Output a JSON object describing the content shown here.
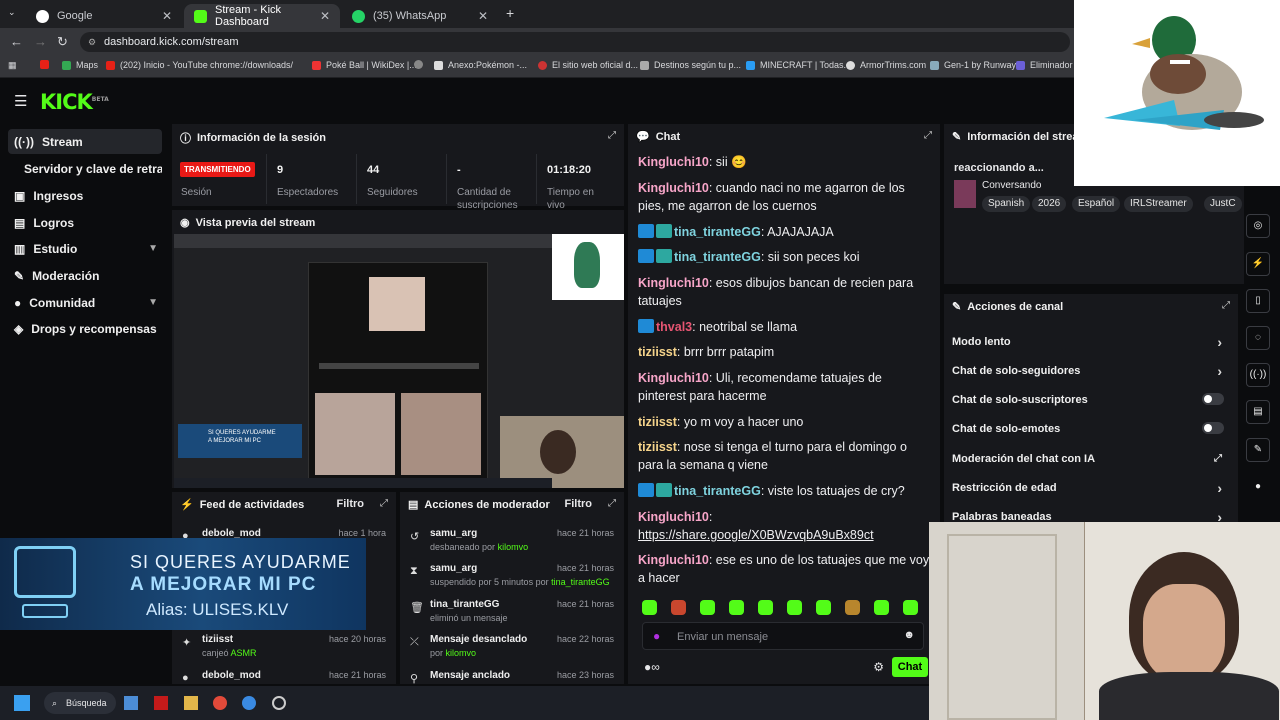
{
  "browser": {
    "tabs": [
      {
        "label": "Google"
      },
      {
        "label": "Stream - Kick Dashboard"
      },
      {
        "label": "(35) WhatsApp"
      }
    ],
    "url": "dashboard.kick.com/stream",
    "bookmarks": [
      "Maps",
      "(202) Inicio - YouTube",
      "chrome://downloads/",
      "Poké Ball | WikiDex |...",
      "Anexo:Pokémon -...",
      "El sitio web oficial d...",
      "Destinos según tu p...",
      "MINECRAFT | Todas...",
      "ArmorTrims.com",
      "Gen-1 by Runway",
      "Eliminador d"
    ]
  },
  "app": {
    "logo": "KICK",
    "logo_sup": "BETA"
  },
  "sidebar": {
    "items": [
      {
        "label": "Stream"
      },
      {
        "label": "Servidor y clave de retransmisión"
      },
      {
        "label": "Ingresos"
      },
      {
        "label": "Logros"
      },
      {
        "label": "Estudio"
      },
      {
        "label": "Moderación"
      },
      {
        "label": "Comunidad"
      },
      {
        "label": "Drops y recompensas"
      }
    ]
  },
  "session": {
    "title": "Información de la sesión",
    "live_badge": "TRANSMITIENDO",
    "session_label": "Sesión",
    "stats": [
      {
        "value": "9",
        "label": "Espectadores"
      },
      {
        "value": "44",
        "label": "Seguidores"
      },
      {
        "value": "-",
        "label": "Cantidad de suscripciones"
      },
      {
        "value": "01:18:20",
        "label": "Tiempo en vivo"
      }
    ]
  },
  "preview": {
    "title": "Vista previa del stream"
  },
  "activity": {
    "title": "Feed de actividades",
    "filter": "Filtro",
    "rows": [
      {
        "name": "debole_mod",
        "time": "hace 1 hora",
        "sub": ""
      },
      {
        "name": "tiziisst",
        "time": "hace 20 horas",
        "sub_pre": "canjeó",
        "sub_hl": "ASMR"
      },
      {
        "name": "debole_mod",
        "time": "hace 21 horas",
        "sub": ""
      }
    ]
  },
  "modactions": {
    "title": "Acciones de moderador",
    "filter": "Filtro",
    "rows": [
      {
        "name": "samu_arg",
        "time": "hace 21 horas",
        "sub_pre": "desbaneado por",
        "sub_hl": "kilomvo"
      },
      {
        "name": "samu_arg",
        "time": "hace 21 horas",
        "sub_pre": "suspendido por 5 minutos por",
        "sub_hl": "tina_tiranteGG"
      },
      {
        "name": "tina_tiranteGG",
        "time": "hace 21 horas",
        "sub_pre": "eliminó un mensaje",
        "sub_hl": ""
      },
      {
        "name": "Mensaje desanclado",
        "time": "hace 22 horas",
        "sub_pre": "por",
        "sub_hl": "kilomvo"
      },
      {
        "name": "Mensaje anclado",
        "time": "hace 23 horas",
        "sub_pre": "",
        "sub_hl": ""
      }
    ]
  },
  "chat": {
    "title": "Chat",
    "messages": [
      {
        "user": "Kingluchi10",
        "text": ": sii 😊"
      },
      {
        "user": "Kingluchi10",
        "text": ": cuando naci no me agarron de los pies, me agarron de los cuernos"
      },
      {
        "user": "tina_tiranteGG",
        "text": ": AJAJAJAJA"
      },
      {
        "user": "tina_tiranteGG",
        "text": ": sii son peces koi"
      },
      {
        "user": "Kingluchi10",
        "text": ": esos dibujos bancan de recien para tatuajes"
      },
      {
        "user": "thval3",
        "text": ": neotribal se llama"
      },
      {
        "user": "tiziisst",
        "text": ": brrr brrr patapim"
      },
      {
        "user": "Kingluchi10",
        "text": ": Uli, recomendame tatuajes de pinterest para hacerme"
      },
      {
        "user": "tiziisst",
        "text": ": yo m voy a hacer uno"
      },
      {
        "user": "tiziisst",
        "text": ": nose si tenga el turno para el domingo o para la semana q viene"
      },
      {
        "user": "tina_tiranteGG",
        "text": ": viste los tatuajes de cry?"
      },
      {
        "user": "Kingluchi10",
        "text": ":"
      },
      {
        "user": "",
        "text": "https://share.google/X0BWzvqbA9uBx89ct"
      },
      {
        "user": "Kingluchi10",
        "text": ": ese es uno de los tatuajes que me voy a hacer"
      }
    ],
    "input_placeholder": "Enviar un mensaje",
    "send_button": "Chat"
  },
  "streaminfo": {
    "title": "Información del stream",
    "reacting": "reaccionando a...",
    "category": "Conversando",
    "tags": [
      "Spanish",
      "2026",
      "Español",
      "IRLStreamer",
      "JustC"
    ]
  },
  "canal": {
    "title": "Acciones de canal",
    "rows": [
      {
        "label": "Modo lento",
        "kind": "arrow"
      },
      {
        "label": "Chat de solo-seguidores",
        "kind": "arrow"
      },
      {
        "label": "Chat de solo-suscriptores",
        "kind": "toggle"
      },
      {
        "label": "Chat de solo-emotes",
        "kind": "toggle"
      },
      {
        "label": "Moderación del chat con IA",
        "kind": "external"
      },
      {
        "label": "Restricción de edad",
        "kind": "arrow"
      },
      {
        "label": "Palabras baneadas",
        "kind": "arrow"
      }
    ]
  },
  "overlay": {
    "banner_line1": "SI QUERES AYUDARME",
    "banner_line2": "A MEJORAR MI PC",
    "banner_line3": "Alias: ULISES.KLV"
  },
  "taskbar": {
    "search": "Búsqueda"
  },
  "colors": {
    "accent": "#53fc18",
    "live": "#e91916",
    "panel": "#17181c"
  }
}
